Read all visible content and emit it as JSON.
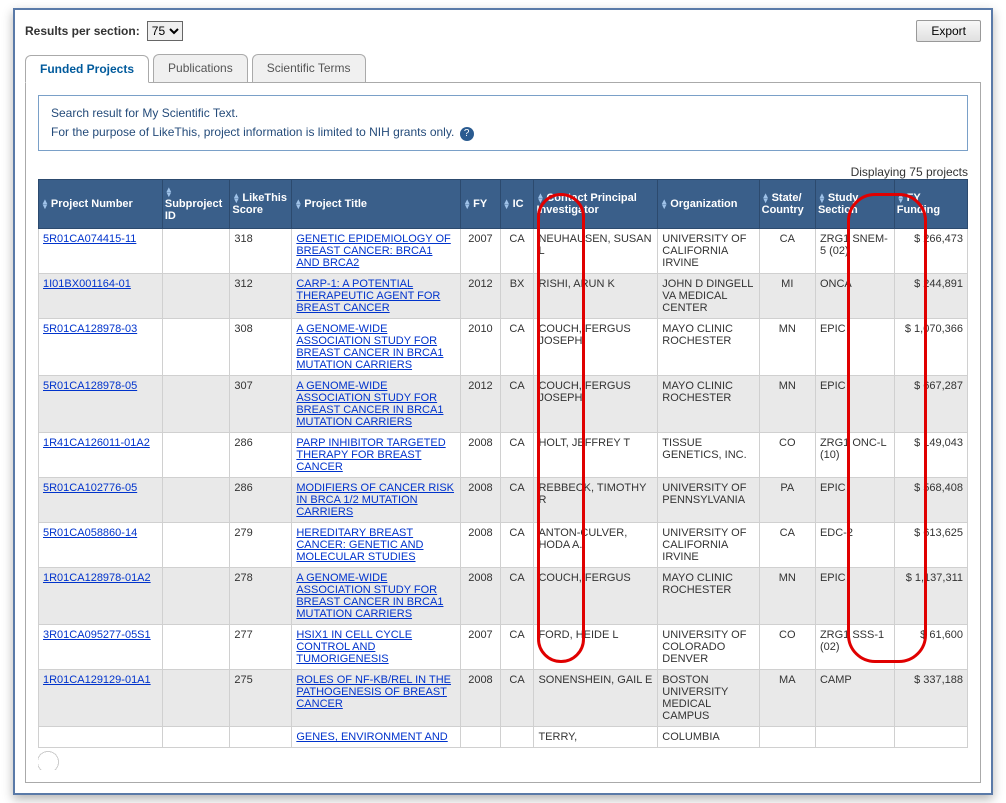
{
  "topbar": {
    "results_per_section_label": "Results per section:",
    "results_per_section_value": "75",
    "export_label": "Export"
  },
  "tabs": [
    {
      "label": "Funded Projects",
      "active": true
    },
    {
      "label": "Publications",
      "active": false
    },
    {
      "label": "Scientific Terms",
      "active": false
    }
  ],
  "info": {
    "line1": "Search result for My Scientific Text.",
    "line2": "For the purpose of LikeThis, project information is limited to NIH grants only."
  },
  "count_text": "Displaying 75 projects",
  "columns": [
    "Project Number",
    "Subproject ID",
    "LikeThis Score",
    "Project Title",
    "FY",
    "IC",
    "Contact Principal Investigator",
    "Organization",
    "State/ Country",
    "Study Section",
    "FY Funding"
  ],
  "rows": [
    {
      "project_number": "5R01CA074415-11",
      "subproject_id": "",
      "likethis_score": "318",
      "project_title": "GENETIC EPIDEMIOLOGY OF BREAST CANCER: BRCA1 AND BRCA2",
      "fy": "2007",
      "ic": "CA",
      "pi": "NEUHAUSEN, SUSAN L",
      "org": "UNIVERSITY OF CALIFORNIA IRVINE",
      "state": "CA",
      "study_section": "ZRG1 SNEM-5 (02)",
      "funding": "$ 266,473"
    },
    {
      "project_number": "1I01BX001164-01",
      "subproject_id": "",
      "likethis_score": "312",
      "project_title": "CARP-1: A POTENTIAL THERAPEUTIC AGENT FOR BREAST CANCER",
      "fy": "2012",
      "ic": "BX",
      "pi": "RISHI, ARUN K",
      "org": "JOHN D DINGELL VA MEDICAL CENTER",
      "state": "MI",
      "study_section": "ONCA",
      "funding": "$ 244,891"
    },
    {
      "project_number": "5R01CA128978-03",
      "subproject_id": "",
      "likethis_score": "308",
      "project_title": "A GENOME-WIDE ASSOCIATION STUDY FOR BREAST CANCER IN BRCA1 MUTATION CARRIERS",
      "fy": "2010",
      "ic": "CA",
      "pi": "COUCH, FERGUS JOSEPH",
      "org": "MAYO CLINIC ROCHESTER",
      "state": "MN",
      "study_section": "EPIC",
      "funding": "$ 1,070,366"
    },
    {
      "project_number": "5R01CA128978-05",
      "subproject_id": "",
      "likethis_score": "307",
      "project_title": "A GENOME-WIDE ASSOCIATION STUDY FOR BREAST CANCER IN BRCA1 MUTATION CARRIERS",
      "fy": "2012",
      "ic": "CA",
      "pi": "COUCH, FERGUS JOSEPH",
      "org": "MAYO CLINIC ROCHESTER",
      "state": "MN",
      "study_section": "EPIC",
      "funding": "$ 667,287"
    },
    {
      "project_number": "1R41CA126011-01A2",
      "subproject_id": "",
      "likethis_score": "286",
      "project_title": "PARP INHIBITOR TARGETED THERAPY FOR BREAST CANCER",
      "fy": "2008",
      "ic": "CA",
      "pi": "HOLT, JEFFREY T",
      "org": "TISSUE GENETICS, INC.",
      "state": "CO",
      "study_section": "ZRG1 ONC-L (10)",
      "funding": "$ 149,043"
    },
    {
      "project_number": "5R01CA102776-05",
      "subproject_id": "",
      "likethis_score": "286",
      "project_title": "MODIFIERS OF CANCER RISK IN BRCA 1/2 MUTATION CARRIERS",
      "fy": "2008",
      "ic": "CA",
      "pi": "REBBECK, TIMOTHY R",
      "org": "UNIVERSITY OF PENNSYLVANIA",
      "state": "PA",
      "study_section": "EPIC",
      "funding": "$ 568,408"
    },
    {
      "project_number": "5R01CA058860-14",
      "subproject_id": "",
      "likethis_score": "279",
      "project_title": "HEREDITARY BREAST CANCER: GENETIC AND MOLECULAR STUDIES",
      "fy": "2008",
      "ic": "CA",
      "pi": "ANTON-CULVER, HODA A.",
      "org": "UNIVERSITY OF CALIFORNIA IRVINE",
      "state": "CA",
      "study_section": "EDC-2",
      "funding": "$ 613,625"
    },
    {
      "project_number": "1R01CA128978-01A2",
      "subproject_id": "",
      "likethis_score": "278",
      "project_title": "A GENOME-WIDE ASSOCIATION STUDY FOR BREAST CANCER IN BRCA1 MUTATION CARRIERS",
      "fy": "2008",
      "ic": "CA",
      "pi": "COUCH, FERGUS",
      "org": "MAYO CLINIC ROCHESTER",
      "state": "MN",
      "study_section": "EPIC",
      "funding": "$ 1,137,311"
    },
    {
      "project_number": "3R01CA095277-05S1",
      "subproject_id": "",
      "likethis_score": "277",
      "project_title": "HSIX1 IN CELL CYCLE CONTROL AND TUMORIGENESIS",
      "fy": "2007",
      "ic": "CA",
      "pi": "FORD, HEIDE L",
      "org": "UNIVERSITY OF COLORADO DENVER",
      "state": "CO",
      "study_section": "ZRG1 SSS-1 (02)",
      "funding": "$ 61,600"
    },
    {
      "project_number": "1R01CA129129-01A1",
      "subproject_id": "",
      "likethis_score": "275",
      "project_title": "ROLES OF NF-KB/REL IN THE PATHOGENESIS OF BREAST CANCER",
      "fy": "2008",
      "ic": "CA",
      "pi": "SONENSHEIN, GAIL E",
      "org": "BOSTON UNIVERSITY MEDICAL CAMPUS",
      "state": "MA",
      "study_section": "CAMP",
      "funding": "$ 337,188"
    },
    {
      "project_number": "",
      "subproject_id": "",
      "likethis_score": "",
      "project_title": "GENES, ENVIRONMENT AND",
      "fy": "",
      "ic": "",
      "pi": "TERRY,",
      "org": "COLUMBIA",
      "state": "",
      "study_section": "",
      "funding": ""
    }
  ]
}
